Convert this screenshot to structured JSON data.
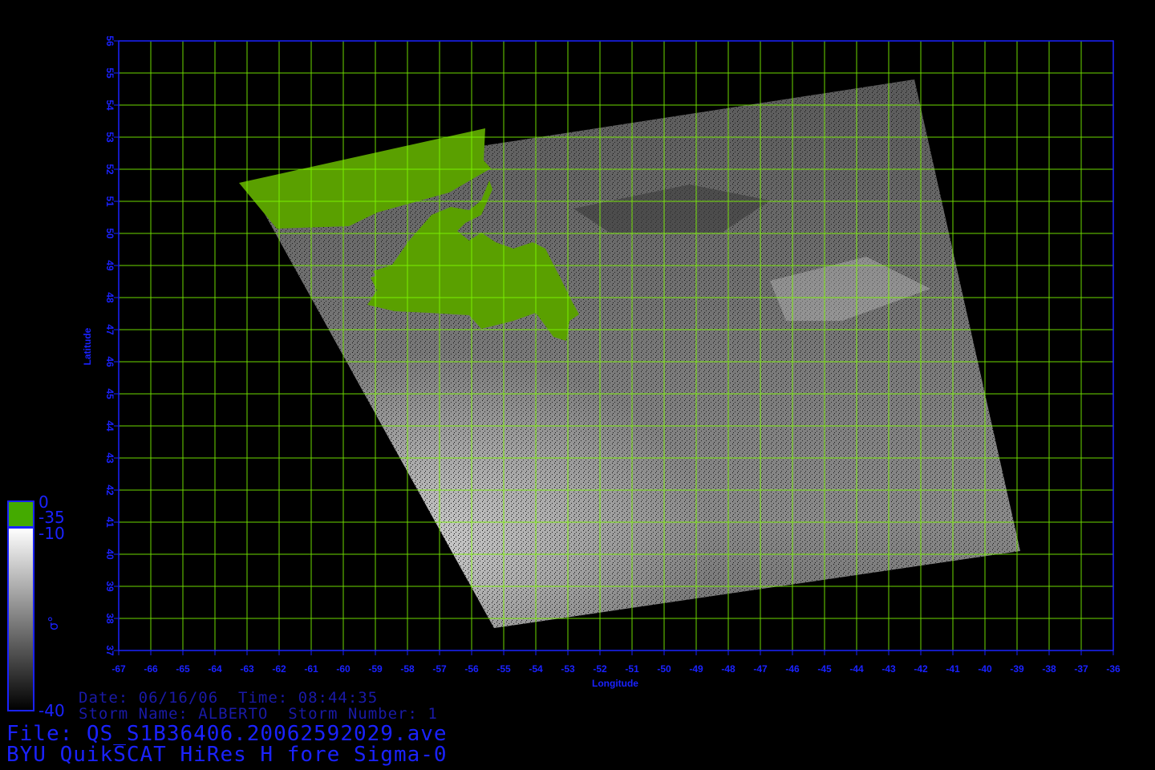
{
  "map": {
    "type": "geographic",
    "lon_range": [
      -67,
      -36
    ],
    "lat_range": [
      37,
      56
    ],
    "lon_ticks": [
      "-67",
      "-66",
      "-65",
      "-64",
      "-63",
      "-62",
      "-61",
      "-60",
      "-59",
      "-58",
      "-57",
      "-56",
      "-55",
      "-54",
      "-53",
      "-52",
      "-51",
      "-50",
      "-49",
      "-48",
      "-47",
      "-46",
      "-45",
      "-44",
      "-43",
      "-42",
      "-41",
      "-40",
      "-39",
      "-38",
      "-37",
      "-36"
    ],
    "lat_ticks": [
      "37",
      "38",
      "39",
      "40",
      "41",
      "42",
      "43",
      "44",
      "45",
      "46",
      "47",
      "48",
      "49",
      "50",
      "51",
      "52",
      "53",
      "54",
      "55",
      "56"
    ],
    "xlabel": "Longitude",
    "ylabel": "Latitude",
    "grid": true,
    "colors": {
      "grid": "#7fff00",
      "axis": "#1a22ff",
      "land": "#5aa000",
      "frame": "#1a22ff"
    },
    "swath_corners_lonlat": [
      [
        -63,
        51.6
      ],
      [
        -42.2,
        54.8
      ],
      [
        -38.9,
        40.1
      ],
      [
        -55.3,
        37.7
      ]
    ]
  },
  "colorbar": {
    "labels": [
      "0",
      "-35",
      "-10",
      "-40"
    ],
    "symbol": "σ°",
    "land_color": "#44aa00"
  },
  "info": {
    "date_line": "Date: 06/16/06  Time: 08:44:35",
    "storm_line": "Storm Name: ALBERTO  Storm Number: 1",
    "file_line": "File: QS_S1B36406.20062592029.ave",
    "product_line": "BYU QuikSCAT HiRes H fore Sigma-0"
  }
}
